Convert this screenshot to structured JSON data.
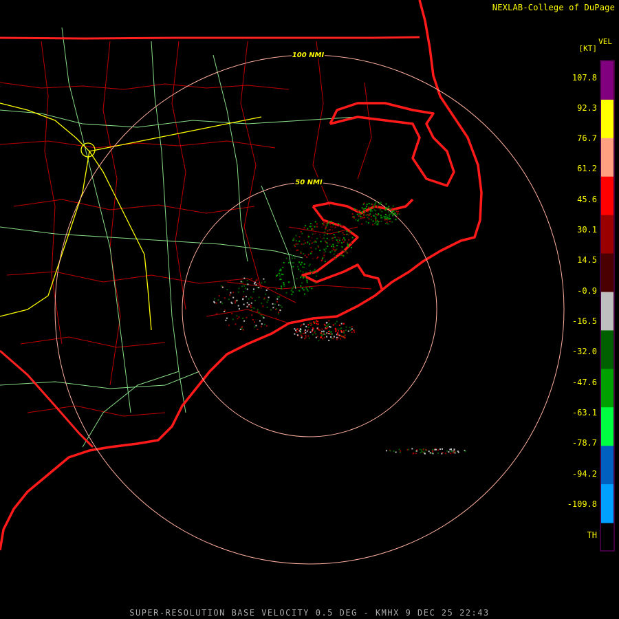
{
  "credit": "NEXLAB-College of DuPage",
  "footer": "SUPER-RESOLUTION BASE VELOCITY 0.5 DEG - KMHX 9 DEC 25 22:43",
  "legend": {
    "product": "VEL",
    "unit": "[KT]",
    "labels": [
      "107.8",
      "92.3",
      "76.7",
      "61.2",
      "45.6",
      "30.1",
      "14.5",
      "-0.9",
      "-16.5",
      "-32.0",
      "-47.6",
      "-63.1",
      "-78.7",
      "-94.2",
      "-109.8",
      "TH"
    ],
    "colors": [
      "#800080",
      "#ffff00",
      "#ffa080",
      "#ff0000",
      "#9b0000",
      "#4a0000",
      "#bfbfbf",
      "#006000",
      "#00a000",
      "#00ff40",
      "#0060c0",
      "#00a0ff"
    ]
  },
  "rings": [
    {
      "label": "50 NMI"
    },
    {
      "label": "100 NMI"
    }
  ]
}
